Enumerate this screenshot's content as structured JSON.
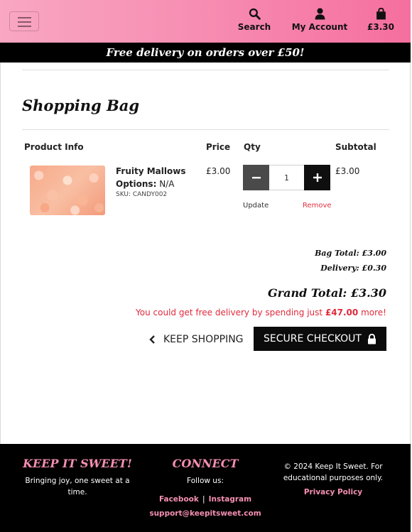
{
  "header": {
    "nav": [
      {
        "label": "Search",
        "icon": "search-icon"
      },
      {
        "label": "My Account",
        "icon": "user-icon"
      },
      {
        "label": "£3.30",
        "icon": "shopping-bag-icon"
      }
    ],
    "gradient_colors": [
      "#f9a7c3",
      "#f56f9e"
    ]
  },
  "promo": {
    "text": "Free delivery on orders over £50!"
  },
  "page": {
    "title": "Shopping Bag"
  },
  "table": {
    "headers": {
      "product": "Product Info",
      "price": "Price",
      "qty": "Qty",
      "subtotal": "Subtotal"
    },
    "items": [
      {
        "name": "Fruity Mallows",
        "options_label": "Options:",
        "options_value": "N/A",
        "sku": "SKU: CANDY002",
        "price": "£3.00",
        "qty": "1",
        "subtotal": "£3.00",
        "update_label": "Update",
        "remove_label": "Remove"
      }
    ]
  },
  "totals": {
    "bag_total": "Bag Total: £3.00",
    "delivery": "Delivery: £0.30",
    "grand_total": "Grand Total: £3.30",
    "free_note_prefix": "You could get free delivery by spending just",
    "free_note_amount": "£47.00",
    "free_note_suffix": "more!"
  },
  "actions": {
    "keep_shopping": "KEEP SHOPPING",
    "checkout": "SECURE CHECKOUT"
  },
  "footer": {
    "brand_title": "KEEP IT SWEET!",
    "brand_tagline": "Bringing joy, one sweet at a time.",
    "connect_title": "CONNECT",
    "follow_label": "Follow us:",
    "facebook": "Facebook",
    "separator": "|",
    "instagram": "Instagram",
    "email": "support@keepitsweet.com",
    "copyright": "© 2024 Keep It Sweet. For educational purposes only.",
    "privacy": "Privacy Policy"
  },
  "colors": {
    "accent_pink": "#f48fb1",
    "remove_red": "#e0303f",
    "note_red": "#e02a3c",
    "dark": "#0b0b0b"
  }
}
